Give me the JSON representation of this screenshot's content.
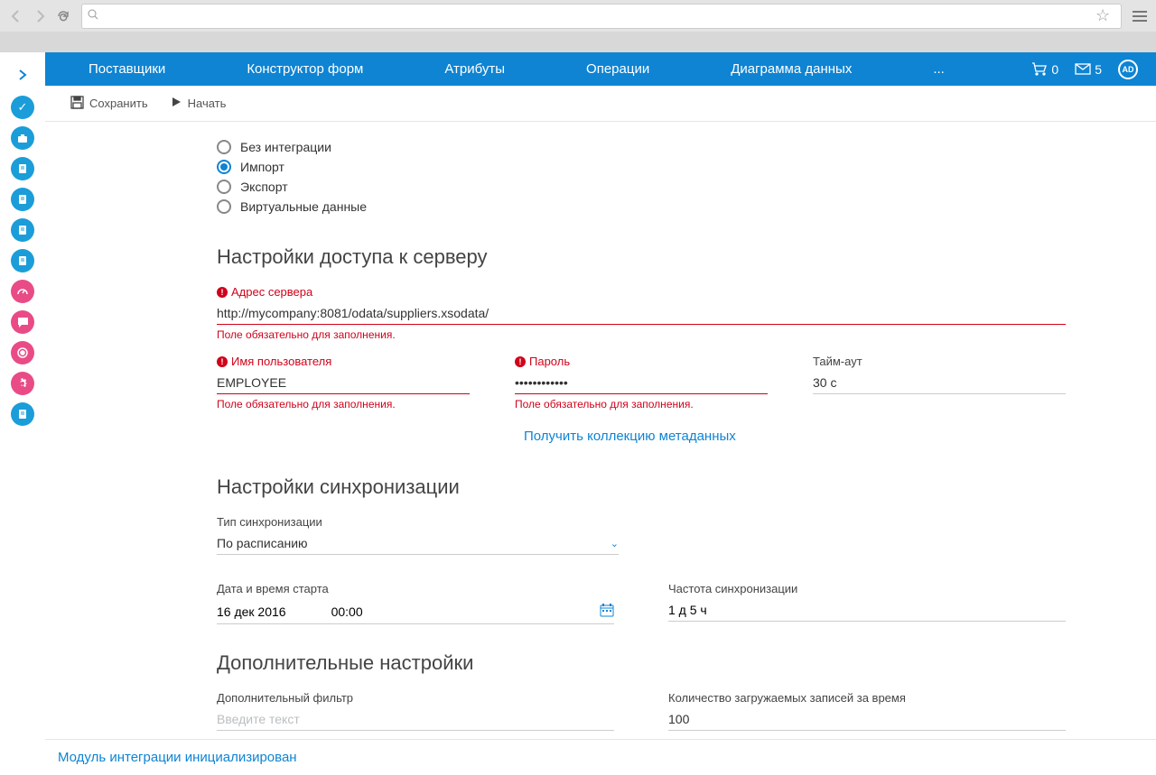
{
  "topnav": {
    "items": [
      "Поставщики",
      "Конструктор форм",
      "Атрибуты",
      "Операции",
      "Диаграмма данных",
      "..."
    ],
    "cart_count": "0",
    "mail_count": "5",
    "avatar": "AD"
  },
  "toolbar": {
    "save": "Сохранить",
    "start": "Начать"
  },
  "integration": {
    "opt_none": "Без интеграции",
    "opt_import": "Импорт",
    "opt_export": "Экспорт",
    "opt_virtual": "Виртуальные данные"
  },
  "server": {
    "title": "Настройки доступа к серверу",
    "addr_label": "Адрес сервера",
    "addr_value": "http://mycompany:8081/odata/suppliers.xsodata/",
    "user_label": "Имя пользователя",
    "user_value": "EMPLOYEE",
    "pass_label": "Пароль",
    "pass_value": "••••••••••••",
    "timeout_label": "Тайм-аут",
    "timeout_value": "30 с",
    "required_msg": "Поле обязательно для заполнения.",
    "metadata_link": "Получить коллекцию метаданных"
  },
  "sync": {
    "title": "Настройки синхронизации",
    "type_label": "Тип синхронизации",
    "type_value": "По расписанию",
    "date_label": "Дата и время старта",
    "date_value": "16 дек 2016",
    "time_value": "00:00",
    "freq_label": "Частота синхронизации",
    "freq_value": "1 д 5 ч"
  },
  "extra": {
    "title": "Дополнительные настройки",
    "filter_label": "Дополнительный фильтр",
    "filter_placeholder": "Введите текст",
    "limit_label": "Количество загружаемых записей за время",
    "limit_value": "100"
  },
  "footer": "Модуль интеграции инициализирован"
}
